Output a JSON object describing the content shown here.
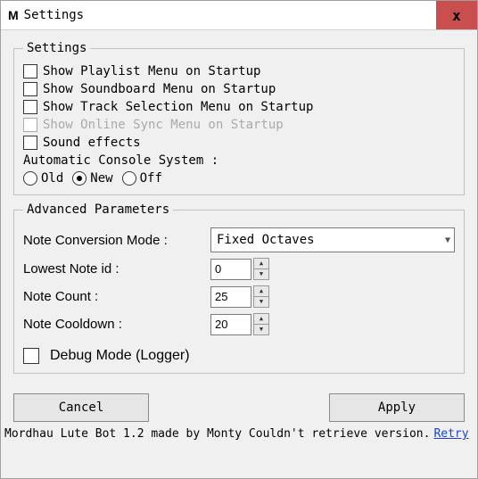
{
  "window": {
    "app_icon": "M",
    "title": "Settings",
    "close_glyph": "x"
  },
  "settings_group": {
    "legend": "Settings",
    "opts": [
      {
        "label": "Show Playlist Menu on Startup",
        "enabled": true
      },
      {
        "label": "Show Soundboard Menu on Startup",
        "enabled": true
      },
      {
        "label": "Show Track Selection Menu on Startup",
        "enabled": true
      },
      {
        "label": "Show Online Sync Menu on Startup",
        "enabled": false
      },
      {
        "label": "Sound effects",
        "enabled": true
      }
    ],
    "console_label": "Automatic Console System :",
    "console_options": [
      "Old",
      "New",
      "Off"
    ],
    "console_selected": "New"
  },
  "advanced_group": {
    "legend": "Advanced Parameters",
    "conversion_label": "Note Conversion Mode :",
    "conversion_value": "Fixed Octaves",
    "lowest_label": "Lowest Note id :",
    "lowest_value": "0",
    "count_label": "Note Count :",
    "count_value": "25",
    "cooldown_label": "Note Cooldown :",
    "cooldown_value": "20",
    "debug_label": "Debug Mode (Logger)"
  },
  "buttons": {
    "cancel": "Cancel",
    "apply": "Apply"
  },
  "footer": {
    "text": "Mordhau Lute Bot 1.2 made by Monty  Couldn't retrieve version.",
    "retry": "Retry"
  }
}
